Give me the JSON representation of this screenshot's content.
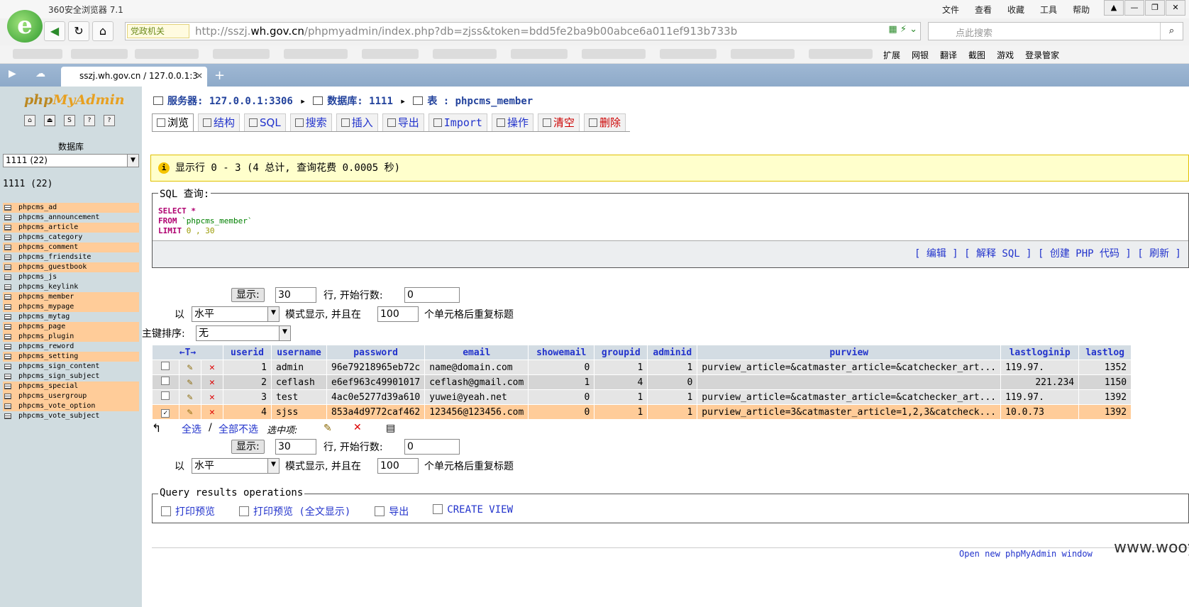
{
  "browser": {
    "title": "360安全浏览器 7.1",
    "menu": [
      "文件",
      "查看",
      "收藏",
      "工具",
      "帮助"
    ],
    "badge": "党政机关",
    "url_prefix": "http://sszj.",
    "url_host": "wh.gov.cn",
    "url_rest": "/phpmyadmin/index.php?db=zjss&token=bdd5fe2ba9b00abce6a011ef913b733b",
    "search_placeholder": "点此搜索",
    "tools": [
      "扩展",
      "网银",
      "翻译",
      "截图",
      "游戏",
      "登录管家"
    ],
    "tab_title": "sszj.wh.gov.cn / 127.0.0.1:3"
  },
  "sidebar": {
    "logo_php": "php",
    "logo_my": "MyAdmin",
    "db_label": "数据库",
    "db_select": "1111 (22)",
    "db_heading": "1111  (22)",
    "tables": [
      "phpcms_ad",
      "phpcms_announcement",
      "phpcms_article",
      "phpcms_category",
      "phpcms_comment",
      "phpcms_friendsite",
      "phpcms_guestbook",
      "phpcms_js",
      "phpcms_keylink",
      "phpcms_member",
      "phpcms_mypage",
      "phpcms_mytag",
      "phpcms_page",
      "phpcms_plugin",
      "phpcms_reword",
      "phpcms_setting",
      "phpcms_sign_content",
      "phpcms_sign_subject",
      "phpcms_special",
      "phpcms_usergroup",
      "phpcms_vote_option",
      "phpcms_vote_subject"
    ]
  },
  "breadcrumb": {
    "server": "服务器: 127.0.0.1:3306",
    "database": "数据库: 1111",
    "table": "表 : phpcms_member"
  },
  "tabs": [
    "浏览",
    "结构",
    "SQL",
    "搜索",
    "插入",
    "导出",
    "Import",
    "操作",
    "清空",
    "删除"
  ],
  "notice": "显示行 0 - 3 (4 总计, 查询花费 0.0005 秒)",
  "sql": {
    "legend": "SQL 查询:",
    "select": "SELECT",
    "star": " *",
    "from": "FROM",
    "table": "`phpcms_member`",
    "limit": "LIMIT",
    "nums": " 0 , 30",
    "tools": "[ 编辑 ] [ 解释 SQL ] [ 创建 PHP 代码 ] [ 刷新 ]"
  },
  "nav": {
    "show_btn": "显示:",
    "rows": "30",
    "rows_label": "行, 开始行数:",
    "start": "0",
    "by": "以",
    "mode": "水平",
    "mode_label": "模式显示, 并且在",
    "repeat": "100",
    "repeat_label": "个单元格后重复标题",
    "pk_label": "主键排序:",
    "pk_value": "无"
  },
  "table": {
    "arrows": "←T→",
    "headers": [
      "userid",
      "username",
      "password",
      "email",
      "showemail",
      "groupid",
      "adminid",
      "purview",
      "lastloginip",
      "lastlog"
    ],
    "rows": [
      [
        "1",
        "admin",
        "96e79218965eb72c",
        "name@domain.com",
        "0",
        "1",
        "1",
        "purview_article=&catmaster_article=&catchecker_art...",
        "119.97.",
        "1352"
      ],
      [
        "2",
        "ceflash",
        "e6ef963c49901017",
        "ceflash@gmail.com",
        "1",
        "4",
        "0",
        "",
        "221.234",
        "1150"
      ],
      [
        "3",
        "test",
        "4ac0e5277d39a610",
        "yuwei@yeah.net",
        "0",
        "1",
        "1",
        "purview_article=&catmaster_article=&catchecker_art...",
        "119.97.",
        "1392"
      ],
      [
        "4",
        "sjss",
        "853a4d9772caf462",
        "123456@123456.com",
        "0",
        "1",
        "1",
        "purview_article=3&catmaster_article=1,2,3&catcheck...",
        "10.0.73",
        "1392"
      ]
    ]
  },
  "footer": {
    "check_all": "全选",
    "sep": "/",
    "uncheck_all": "全部不选",
    "with_selected": "选中项:"
  },
  "qro": {
    "legend": "Query results operations",
    "ops": [
      "打印预览",
      "打印预览 (全文显示)",
      "导出",
      "CREATE VIEW"
    ]
  },
  "new_window": "Open new phpMyAdmin window",
  "watermark": "www.wooyun.org"
}
